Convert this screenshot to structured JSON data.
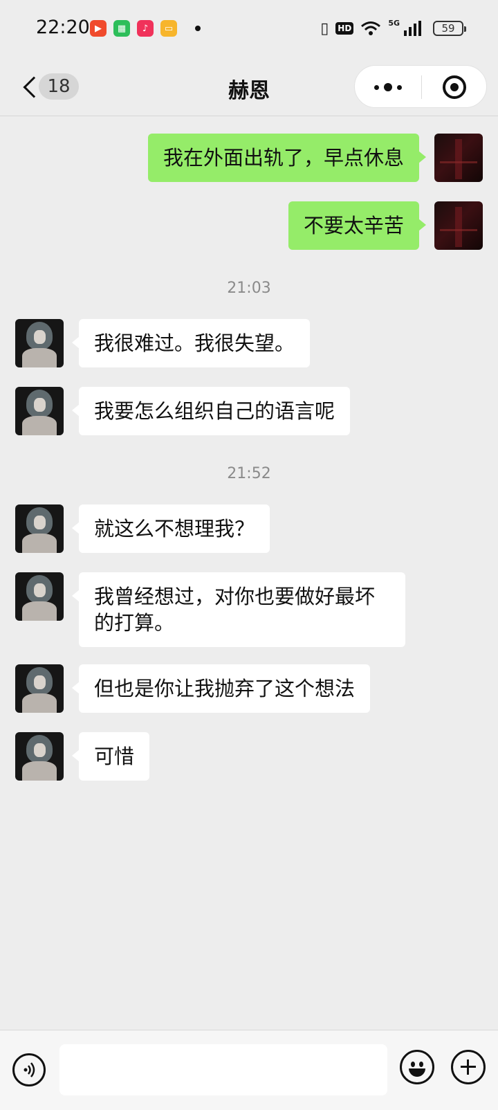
{
  "status_bar": {
    "time": "22:20",
    "notification_apps": [
      {
        "icon": "video-app-icon",
        "color": "#f04a2c"
      },
      {
        "icon": "store-app-icon",
        "color": "#2dbe5a"
      },
      {
        "icon": "music-app-icon",
        "color": "#f0325a"
      },
      {
        "icon": "reader-app-icon",
        "color": "#f7b52c"
      }
    ],
    "hd_label": "HD",
    "network_label": "5G",
    "battery_level": "59"
  },
  "nav": {
    "unread_count": "18",
    "title": "赫恩"
  },
  "messages": [
    {
      "side": "right",
      "text": "我在外面出轨了，早点休息"
    },
    {
      "side": "right",
      "text": "不要太辛苦"
    },
    {
      "type": "time",
      "text": "21:03"
    },
    {
      "side": "left",
      "text": "我很难过。我很失望。"
    },
    {
      "side": "left",
      "text": "我要怎么组织自己的语言呢"
    },
    {
      "type": "time",
      "text": "21:52"
    },
    {
      "side": "left",
      "text": "就这么不想理我？"
    },
    {
      "side": "left",
      "text": "我曾经想过，对你也要做好最坏的打算。"
    },
    {
      "side": "left",
      "text": "但也是你让我抛弃了这个想法"
    },
    {
      "side": "left",
      "text": "可惜"
    }
  ],
  "input_bar": {
    "input_value": "",
    "placeholder": ""
  },
  "colors": {
    "background": "#ededed",
    "self_bubble": "#95ec69",
    "other_bubble": "#ffffff"
  }
}
